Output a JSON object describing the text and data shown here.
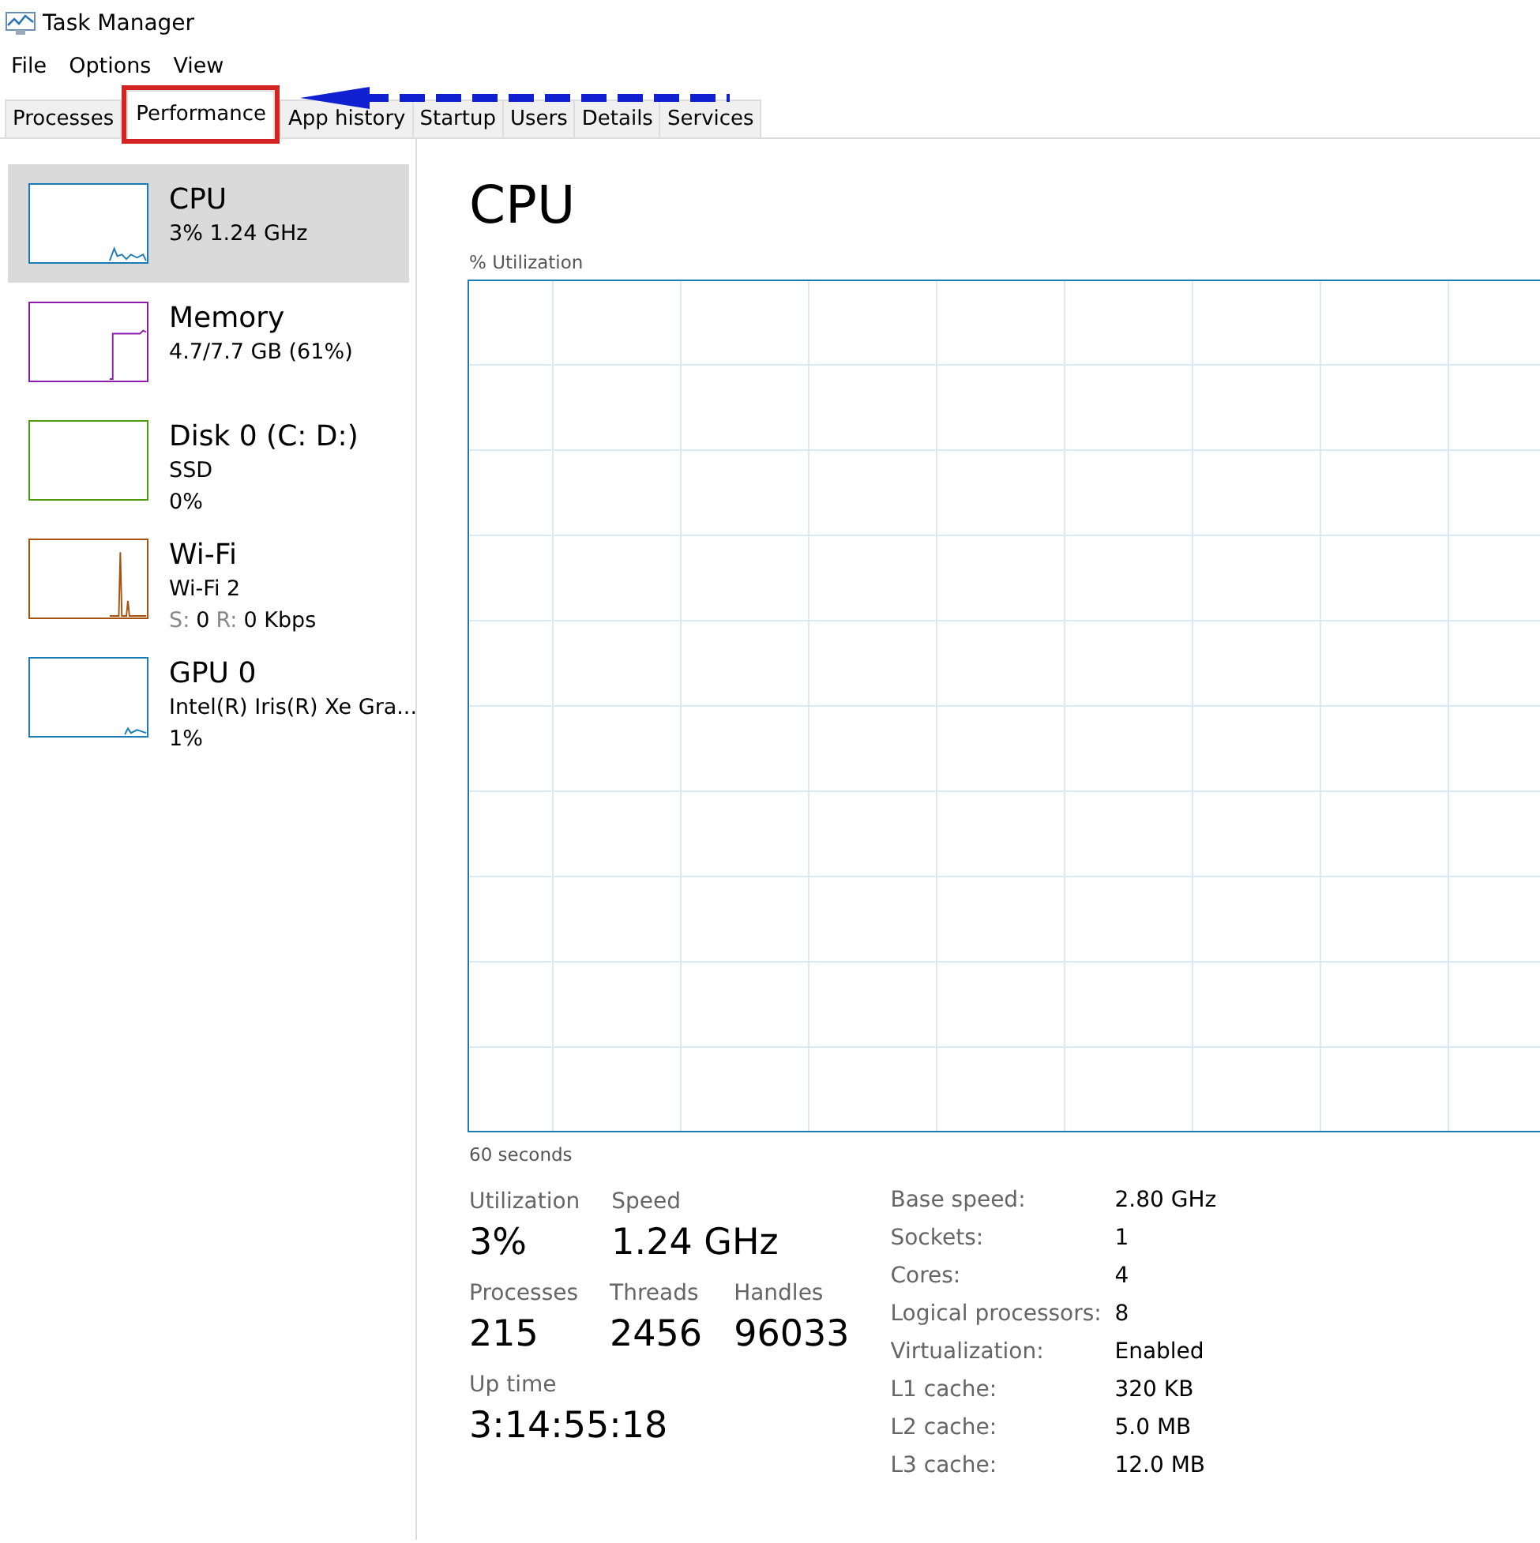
{
  "window": {
    "title": "Task Manager"
  },
  "menu": [
    "File",
    "Options",
    "View"
  ],
  "tabs": [
    {
      "label": "Processes",
      "selected": false,
      "highlighted": false
    },
    {
      "label": "Performance",
      "selected": true,
      "highlighted": true
    },
    {
      "label": "App history",
      "selected": false,
      "highlighted": false
    },
    {
      "label": "Startup",
      "selected": false,
      "highlighted": false
    },
    {
      "label": "Users",
      "selected": false,
      "highlighted": false
    },
    {
      "label": "Details",
      "selected": false,
      "highlighted": false
    },
    {
      "label": "Services",
      "selected": false,
      "highlighted": false
    }
  ],
  "annotation": {
    "kind": "arrow"
  },
  "sidebar": {
    "items": [
      {
        "name": "CPU",
        "selected": true,
        "color": "#1b7bb5",
        "lines": [
          [
            {
              "text": "3%  1.24 GHz",
              "dim": false
            }
          ]
        ]
      },
      {
        "name": "Memory",
        "selected": false,
        "color": "#8e1aae",
        "lines": [
          [
            {
              "text": "4.7/7.7 GB (61%)",
              "dim": false
            }
          ]
        ]
      },
      {
        "name": "Disk 0 (C: D:)",
        "selected": false,
        "color": "#4e9a0c",
        "lines": [
          [
            {
              "text": "SSD",
              "dim": false
            }
          ],
          [
            {
              "text": "0%",
              "dim": false
            }
          ]
        ]
      },
      {
        "name": "Wi-Fi",
        "selected": false,
        "color": "#a5520f",
        "lines": [
          [
            {
              "text": "Wi-Fi 2",
              "dim": false
            }
          ],
          [
            {
              "text": "S:",
              "dim": true
            },
            {
              "text": "0",
              "dim": false
            },
            {
              "text": "R:",
              "dim": true
            },
            {
              "text": "0 Kbps",
              "dim": false
            }
          ]
        ]
      },
      {
        "name": "GPU 0",
        "selected": false,
        "color": "#1b7bb5",
        "lines": [
          [
            {
              "text": "Intel(R) Iris(R) Xe Gra...",
              "dim": false
            }
          ],
          [
            {
              "text": "1%",
              "dim": false
            }
          ]
        ]
      }
    ]
  },
  "main": {
    "title": "CPU",
    "chart_label": "% Utilization",
    "time_label": "60 seconds",
    "stats": [
      [
        {
          "label": "Utilization",
          "value": "3%"
        },
        {
          "label": "Speed",
          "value": "1.24 GHz"
        }
      ],
      [
        {
          "label": "Processes",
          "value": "215"
        },
        {
          "label": "Threads",
          "value": "2456"
        },
        {
          "label": "Handles",
          "value": "96033"
        }
      ],
      [
        {
          "label": "Up time",
          "value": "3:14:55:18"
        }
      ]
    ],
    "details": [
      {
        "key": "Base speed:",
        "value": "2.80 GHz"
      },
      {
        "key": "Sockets:",
        "value": "1"
      },
      {
        "key": "Cores:",
        "value": "4"
      },
      {
        "key": "Logical processors:",
        "value": "8"
      },
      {
        "key": "Virtualization:",
        "value": "Enabled"
      },
      {
        "key": "L1 cache:",
        "value": "320 KB"
      },
      {
        "key": "L2 cache:",
        "value": "5.0 MB"
      },
      {
        "key": "L3 cache:",
        "value": "12.0 MB"
      }
    ]
  }
}
